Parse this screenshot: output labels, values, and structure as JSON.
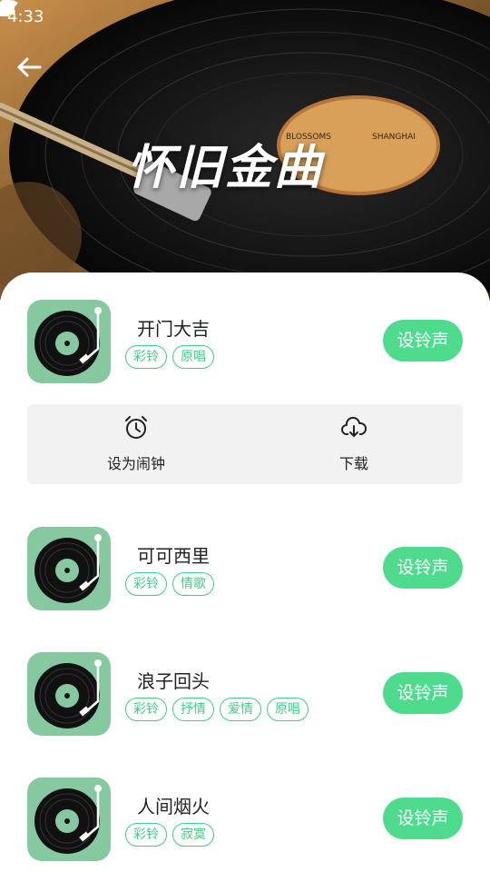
{
  "status": {
    "time": "4:33",
    "icons": [
      "a-notification-icon",
      "wifi-icon",
      "cell-signal-icon",
      "battery-icon"
    ]
  },
  "header": {
    "title": "怀旧金曲",
    "album_text_left": "BLOSSOMS",
    "album_text_right": "SHANGHAI",
    "back_icon": "back-arrow-icon"
  },
  "accent_color": "#4fdb8e",
  "songs": [
    {
      "title": "开门大吉",
      "tags": [
        "彩铃",
        "原唱"
      ],
      "button": "设铃声"
    },
    {
      "title": "可可西里",
      "tags": [
        "彩铃",
        "情歌"
      ],
      "button": "设铃声"
    },
    {
      "title": "浪子回头",
      "tags": [
        "彩铃",
        "抒情",
        "爱情",
        "原唱"
      ],
      "button": "设铃声"
    },
    {
      "title": "人间烟火",
      "tags": [
        "彩铃",
        "寂寞"
      ],
      "button": "设铃声"
    }
  ],
  "actions": {
    "alarm": {
      "label": "设为闹钟",
      "icon": "alarm-clock-icon"
    },
    "download": {
      "label": "下载",
      "icon": "cloud-download-icon"
    }
  }
}
